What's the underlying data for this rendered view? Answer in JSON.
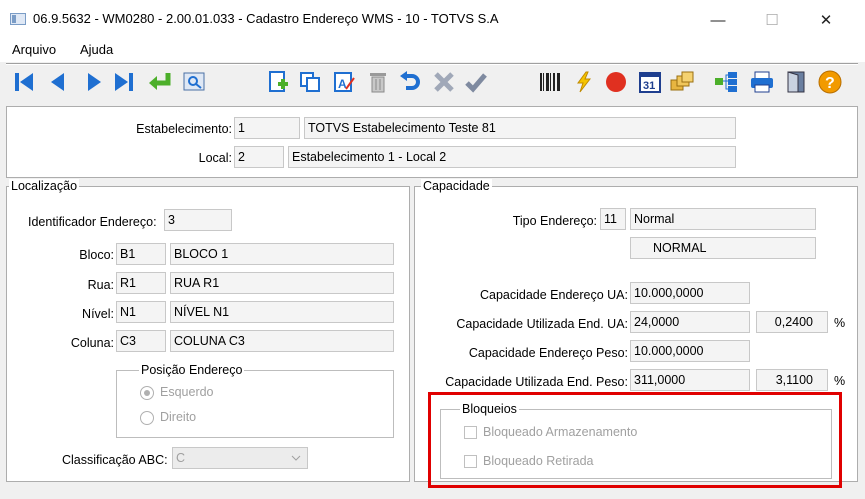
{
  "window": {
    "title": "06.9.5632 - WM0280 - 2.00.01.033 - Cadastro Endereço WMS - 10 - TOTVS S.A",
    "minimize": "—",
    "maximize": "☐",
    "close": "✕"
  },
  "menu": {
    "items": [
      "Arquivo",
      "Ajuda"
    ]
  },
  "toolbar": {
    "icons": [
      "first-record-icon",
      "previous-record-icon",
      "next-record-icon",
      "last-record-icon",
      "goto-icon",
      "search-zoom-icon",
      "new-icon",
      "copy-icon",
      "edit-icon",
      "delete-icon",
      "undo-icon",
      "cancel-icon",
      "save-check-icon",
      "barcode-icon",
      "lightning-icon",
      "stop-icon",
      "calendar-icon",
      "folders-icon",
      "tree-icon",
      "print-icon",
      "exit-door-icon",
      "help-icon"
    ],
    "calendar_day": "31",
    "help_glyph": "?"
  },
  "header": {
    "estabelecimento_label": "Estabelecimento:",
    "estabelecimento_code": "1",
    "estabelecimento_name": "TOTVS Estabelecimento Teste 81",
    "local_label": "Local:",
    "local_code": "2",
    "local_name": "Estabelecimento 1 - Local 2"
  },
  "localizacao": {
    "title": "Localização",
    "identificador_label": "Identificador Endereço:",
    "identificador_value": "3",
    "bloco_label": "Bloco:",
    "bloco_code": "B1",
    "bloco_desc": "BLOCO 1",
    "rua_label": "Rua:",
    "rua_code": "R1",
    "rua_desc": "RUA R1",
    "nivel_label": "Nível:",
    "nivel_code": "N1",
    "nivel_desc": "NÍVEL N1",
    "coluna_label": "Coluna:",
    "coluna_code": "C3",
    "coluna_desc": "COLUNA C3",
    "posicao_title": "Posição Endereço",
    "posicao_options": [
      "Esquerdo",
      "Direito"
    ],
    "posicao_selected": "Esquerdo",
    "classificacao_label": "Classificação ABC:",
    "classificacao_value": "C"
  },
  "capacidade": {
    "title": "Capacidade",
    "tipo_label": "Tipo Endereço:",
    "tipo_code": "11",
    "tipo_desc": "Normal",
    "tipo_desc2": "NORMAL",
    "cap_ua_label": "Capacidade Endereço UA:",
    "cap_ua_value": "10.000,0000",
    "cap_util_ua_label": "Capacidade Utilizada End. UA:",
    "cap_util_ua_value": "24,0000",
    "cap_util_ua_pct": "0,2400",
    "cap_peso_label": "Capacidade Endereço Peso:",
    "cap_peso_value": "10.000,0000",
    "cap_util_peso_label": "Capacidade Utilizada End. Peso:",
    "cap_util_peso_value": "311,0000",
    "cap_util_peso_pct": "3,1100",
    "pct_symbol": "%"
  },
  "bloqueios": {
    "title": "Bloqueios",
    "armazenamento_label": "Bloqueado Armazenamento",
    "armazenamento_checked": false,
    "retirada_label": "Bloqueado Retirada",
    "retirada_checked": false
  },
  "colors": {
    "highlight_box": "#e00000",
    "toolbar_blue": "#1f6fd1",
    "toolbar_green": "#4caf2a",
    "stop_red": "#e03020",
    "help_orange": "#f29a00"
  }
}
